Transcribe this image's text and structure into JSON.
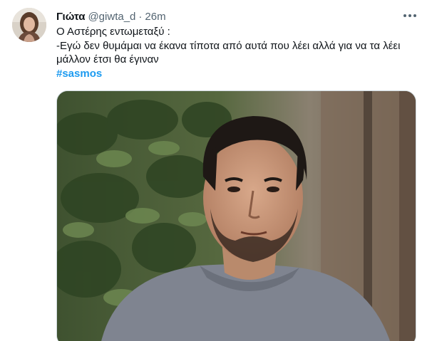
{
  "author": {
    "display_name": "Γιώτα",
    "handle": "@giwta_d",
    "separator": "·",
    "time": "26m"
  },
  "tweet": {
    "lines": [
      "Ο Αστέρης εντωμεταξύ :",
      "-Εγώ δεν θυμάμαι να έκανα τίποτα από αυτά που λέει αλλά για να τα λέει",
      "μάλλον έτσι θα έγιναν"
    ],
    "hashtag": "#sasmos"
  },
  "icons": {
    "more": "more-dots-icon"
  },
  "colors": {
    "text": "#0f1419",
    "secondary": "#536471",
    "link": "#1d9bf0"
  }
}
